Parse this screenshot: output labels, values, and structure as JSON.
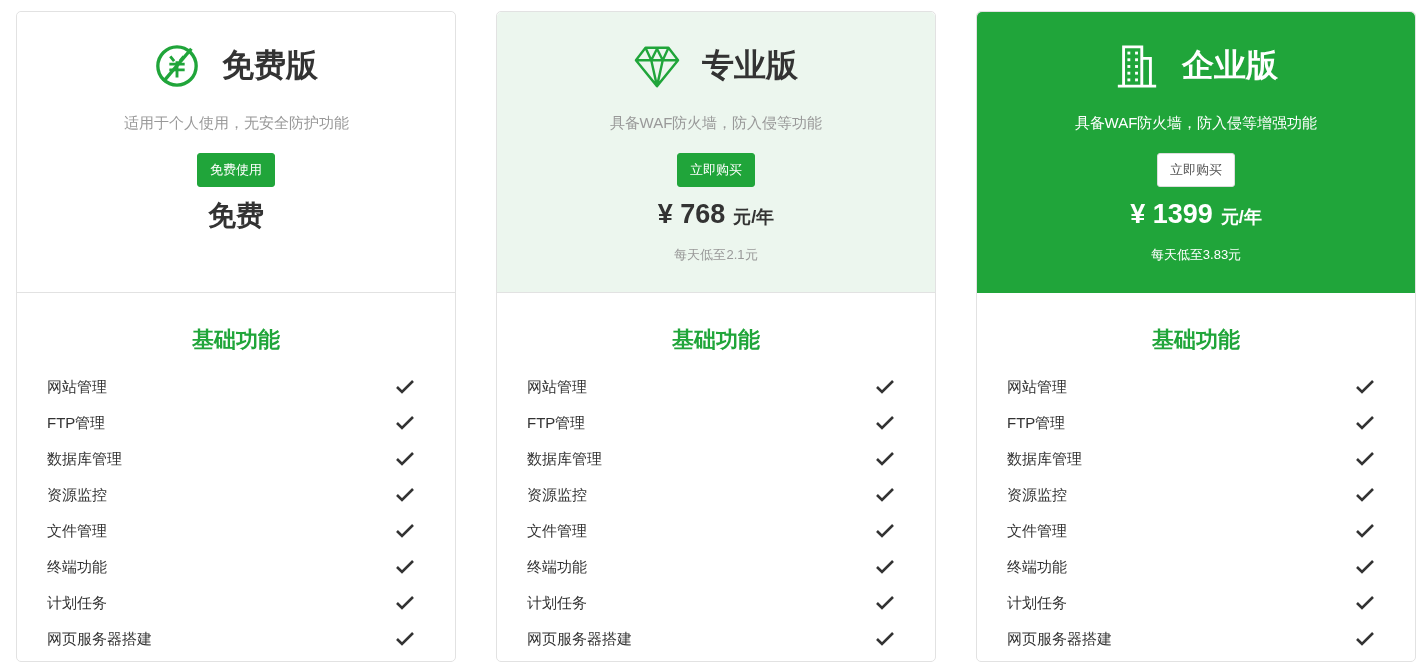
{
  "plans": [
    {
      "kind": "free",
      "title": "免费版",
      "description": "适用于个人使用，无安全防护功能",
      "button": "免费使用",
      "price": {
        "kind": "text",
        "text": "免费"
      },
      "features_title": "基础功能",
      "features": [
        {
          "label": "网站管理",
          "included": true
        },
        {
          "label": "FTP管理",
          "included": true
        },
        {
          "label": "数据库管理",
          "included": true
        },
        {
          "label": "资源监控",
          "included": true
        },
        {
          "label": "文件管理",
          "included": true
        },
        {
          "label": "终端功能",
          "included": true
        },
        {
          "label": "计划任务",
          "included": true
        },
        {
          "label": "网页服务器搭建",
          "included": true
        }
      ]
    },
    {
      "kind": "pro",
      "title": "专业版",
      "description": "具备WAF防火墙，防入侵等功能",
      "button": "立即购买",
      "price": {
        "kind": "amount",
        "symbol": "¥",
        "amount": "768",
        "unit": "元/年",
        "note": "每天低至2.1元"
      },
      "features_title": "基础功能",
      "features": [
        {
          "label": "网站管理",
          "included": true
        },
        {
          "label": "FTP管理",
          "included": true
        },
        {
          "label": "数据库管理",
          "included": true
        },
        {
          "label": "资源监控",
          "included": true
        },
        {
          "label": "文件管理",
          "included": true
        },
        {
          "label": "终端功能",
          "included": true
        },
        {
          "label": "计划任务",
          "included": true
        },
        {
          "label": "网页服务器搭建",
          "included": true
        }
      ]
    },
    {
      "kind": "enterprise",
      "title": "企业版",
      "description": "具备WAF防火墙，防入侵等增强功能",
      "button": "立即购买",
      "price": {
        "kind": "amount",
        "symbol": "¥",
        "amount": "1399",
        "unit": "元/年",
        "note": "每天低至3.83元"
      },
      "features_title": "基础功能",
      "features": [
        {
          "label": "网站管理",
          "included": true
        },
        {
          "label": "FTP管理",
          "included": true
        },
        {
          "label": "数据库管理",
          "included": true
        },
        {
          "label": "资源监控",
          "included": true
        },
        {
          "label": "文件管理",
          "included": true
        },
        {
          "label": "终端功能",
          "included": true
        },
        {
          "label": "计划任务",
          "included": true
        },
        {
          "label": "网页服务器搭建",
          "included": true
        }
      ]
    }
  ]
}
